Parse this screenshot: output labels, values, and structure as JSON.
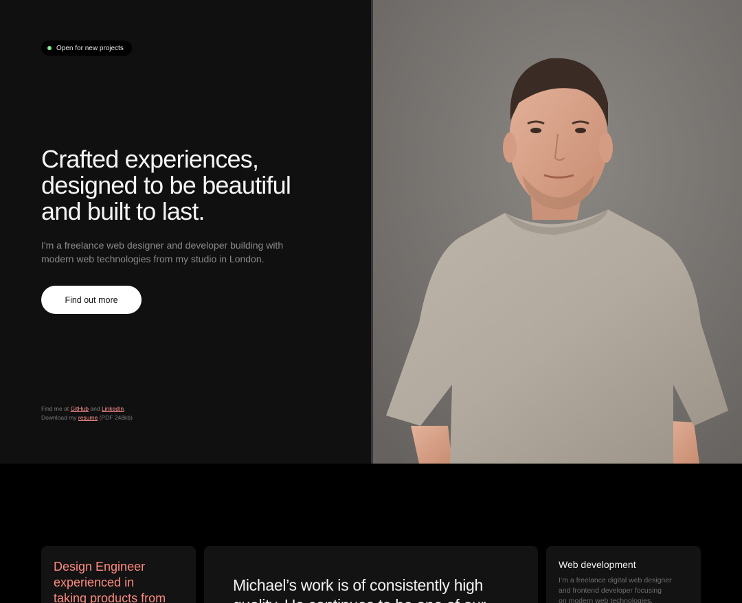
{
  "hero": {
    "status": "Open for new projects",
    "headline": [
      "Crafted experiences,",
      "designed to be beautiful",
      "and built to last."
    ],
    "intro": [
      "I'm a freelance web designer and developer building with",
      "modern web technologies from my studio in London."
    ],
    "cta_label": "Find out more",
    "links": {
      "find_me_prefix": "Find me at",
      "github": "GitHub",
      "and": "and",
      "linkedin": "LinkedIn",
      "period": ".",
      "download_prefix": "Download my",
      "resume": "resume",
      "resume_meta": "(PDF 248kb)"
    }
  },
  "cards": {
    "role": [
      "Design Engineer",
      "experienced in",
      "taking products from"
    ],
    "quote": [
      "Michael’s work is of consistently high",
      "quality. He continues to be one of our"
    ],
    "service": {
      "title": "Web development",
      "desc": [
        "I’m a freelance digital web designer",
        "and frontend developer focusing",
        "on modern web technologies."
      ]
    }
  },
  "colors": {
    "status_dot": "#7ef08e",
    "accent": "#ff8a80",
    "link": "#ff8e8e",
    "hero_bg": "#101010",
    "page_bg": "#000000"
  }
}
